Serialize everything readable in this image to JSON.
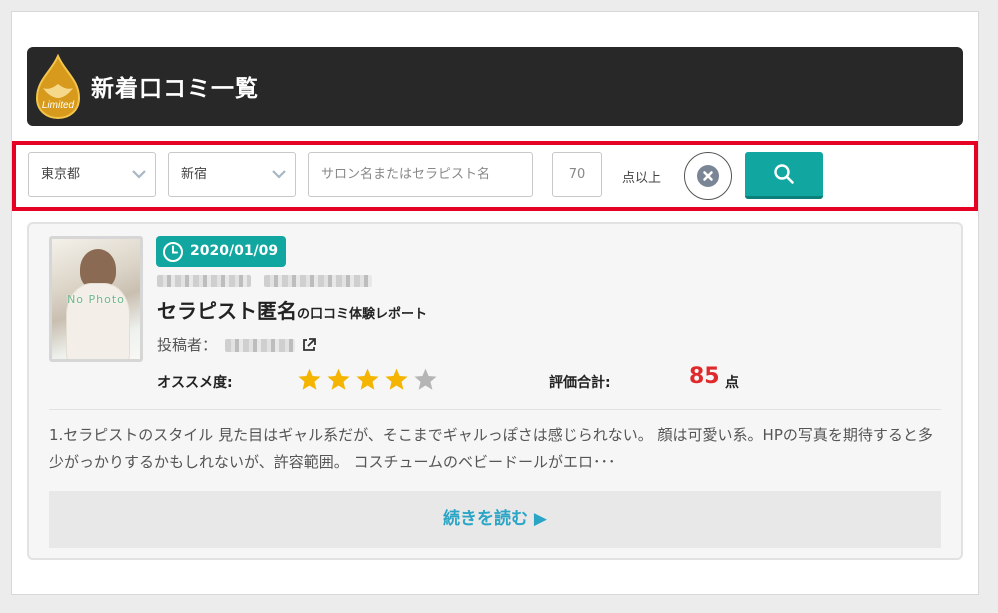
{
  "header": {
    "logo_text": "Limited",
    "title": "新着口コミ一覧"
  },
  "search": {
    "prefecture": "東京都",
    "area": "新宿",
    "keyword_placeholder": "サロン名またはセラピスト名",
    "score_value": "70",
    "score_suffix": "点以上"
  },
  "review": {
    "thumbnail_label": "No Photo",
    "date": "2020/01/09",
    "therapist_name": "セラピスト匿名",
    "title_suffix": "の口コミ体験レポート",
    "poster_label": "投稿者：",
    "recommendation_label": "オススメ度:",
    "rating_stars": 4,
    "rating_max": 5,
    "total_label": "評価合計:",
    "total_score": "85",
    "total_unit": "点",
    "excerpt": "1.セラピストのスタイル 見た目はギャル系だが、そこまでギャルっぽさは感じられない。 顔は可愛い系。HPの写真を期待すると多少がっかりするかもしれないが、許容範囲。 コスチュームのベビードールがエロ･･･",
    "read_more": "続きを読む ▶"
  },
  "colors": {
    "accent": "#11a7a0",
    "header_bg": "#282828",
    "highlight_border": "#e60023",
    "score_red": "#e0292b",
    "star_on": "#f4b400",
    "star_off": "#b5b5b5",
    "link": "#2aa5c6"
  },
  "icons": {
    "clock": "clock-icon",
    "external": "external-link-icon",
    "search": "search-icon",
    "clear": "close-icon",
    "chevron": "chevron-down-icon"
  }
}
